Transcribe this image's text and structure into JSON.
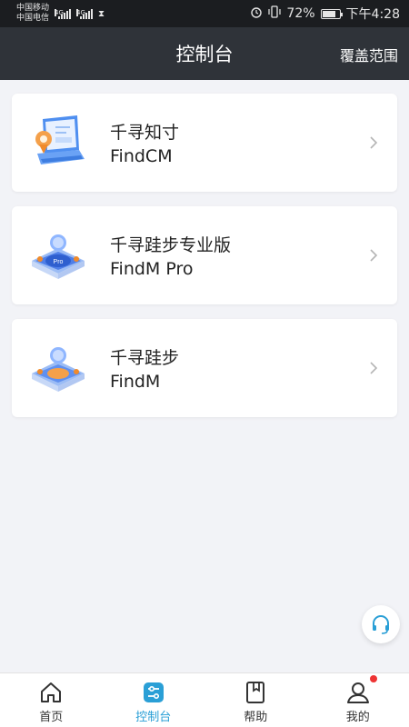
{
  "status_bar": {
    "carrier1": "中国移动",
    "carrier2": "中国电信",
    "net1": "4G",
    "net2": "4G",
    "battery": "72%",
    "time": "下午4:28"
  },
  "header": {
    "title": "控制台",
    "action_label": "覆盖范围"
  },
  "products": [
    {
      "title": "千寻知寸",
      "subtitle": "FindCM",
      "icon": "laptop-icon"
    },
    {
      "title": "千寻跬步专业版",
      "subtitle": "FindM Pro",
      "icon": "location-platform-pro-icon",
      "icon_badge": "Pro"
    },
    {
      "title": "千寻跬步",
      "subtitle": "FindM",
      "icon": "location-platform-icon"
    }
  ],
  "tabbar": {
    "items": [
      {
        "label": "首页",
        "icon": "home-icon",
        "active": false
      },
      {
        "label": "控制台",
        "icon": "console-icon",
        "active": true
      },
      {
        "label": "帮助",
        "icon": "help-book-icon",
        "active": false
      },
      {
        "label": "我的",
        "icon": "profile-icon",
        "active": false,
        "badge": true
      }
    ]
  },
  "colors": {
    "header_bg": "#2f3339",
    "accent": "#2a9fd6",
    "page_bg": "#f2f3f7",
    "badge": "#ee3333"
  }
}
